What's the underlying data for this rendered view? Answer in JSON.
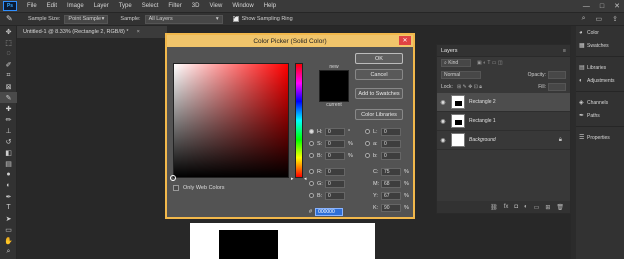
{
  "menubar": {
    "logo": "Ps",
    "items": [
      "File",
      "Edit",
      "Image",
      "Layer",
      "Type",
      "Select",
      "Filter",
      "3D",
      "View",
      "Window",
      "Help"
    ],
    "win_controls": [
      "—",
      "□",
      "✕"
    ]
  },
  "optbar": {
    "sample_size_label": "Sample Size:",
    "sample_size_value": "Point Sample",
    "sample_label": "Sample:",
    "sample_value": "All Layers",
    "show_ring_label": "Show Sampling Ring"
  },
  "document": {
    "tab_title": "Untitled-1 @ 8.33% (Rectangle 2, RGB/8) *",
    "tab_close": "×"
  },
  "dialog": {
    "title": "Color Picker (Solid Color)",
    "new_label": "new",
    "current_label": "current",
    "ok": "OK",
    "cancel": "Cancel",
    "add_swatches": "Add to Swatches",
    "color_libraries": "Color Libraries",
    "only_web_colors": "Only Web Colors",
    "hsb": [
      {
        "key": "H:",
        "value": "0",
        "unit": "°"
      },
      {
        "key": "S:",
        "value": "0",
        "unit": "%"
      },
      {
        "key": "B:",
        "value": "0",
        "unit": "%"
      }
    ],
    "rgb": [
      {
        "key": "R:",
        "value": "0"
      },
      {
        "key": "G:",
        "value": "0"
      },
      {
        "key": "B:",
        "value": "0"
      }
    ],
    "lab": [
      {
        "key": "L:",
        "value": "0"
      },
      {
        "key": "a:",
        "value": "0"
      },
      {
        "key": "b:",
        "value": "0"
      }
    ],
    "cmyk": [
      {
        "key": "C:",
        "value": "75",
        "unit": "%"
      },
      {
        "key": "M:",
        "value": "68",
        "unit": "%"
      },
      {
        "key": "Y:",
        "value": "67",
        "unit": "%"
      },
      {
        "key": "K:",
        "value": "90",
        "unit": "%"
      }
    ],
    "hex_key": "#",
    "hex_value": "000000",
    "new_color": "#000000"
  },
  "layers": {
    "tab": "Layers",
    "kind_label": "Kind",
    "blend_mode": "Normal",
    "opacity_label": "Opacity:",
    "lock_label": "Lock:",
    "fill_label": "Fill:",
    "items": [
      {
        "name": "Rectangle 2",
        "selected": true
      },
      {
        "name": "Rectangle 1",
        "selected": false
      },
      {
        "name": "Background",
        "selected": false
      }
    ],
    "footer_icons": [
      "link-icon",
      "fx-icon",
      "mask-icon",
      "adjustment-icon",
      "folder-icon",
      "new-layer-icon",
      "trash-icon"
    ]
  },
  "dock": {
    "items": [
      "Color",
      "Swatches",
      "Libraries",
      "Adjustments",
      "Channels",
      "Paths",
      "Properties"
    ]
  },
  "colors": {
    "dialog_border": "#f2b84b",
    "title_bar": "#f1c56b",
    "close_btn": "#e04343",
    "hex_highlight": "#2f6fd6"
  }
}
